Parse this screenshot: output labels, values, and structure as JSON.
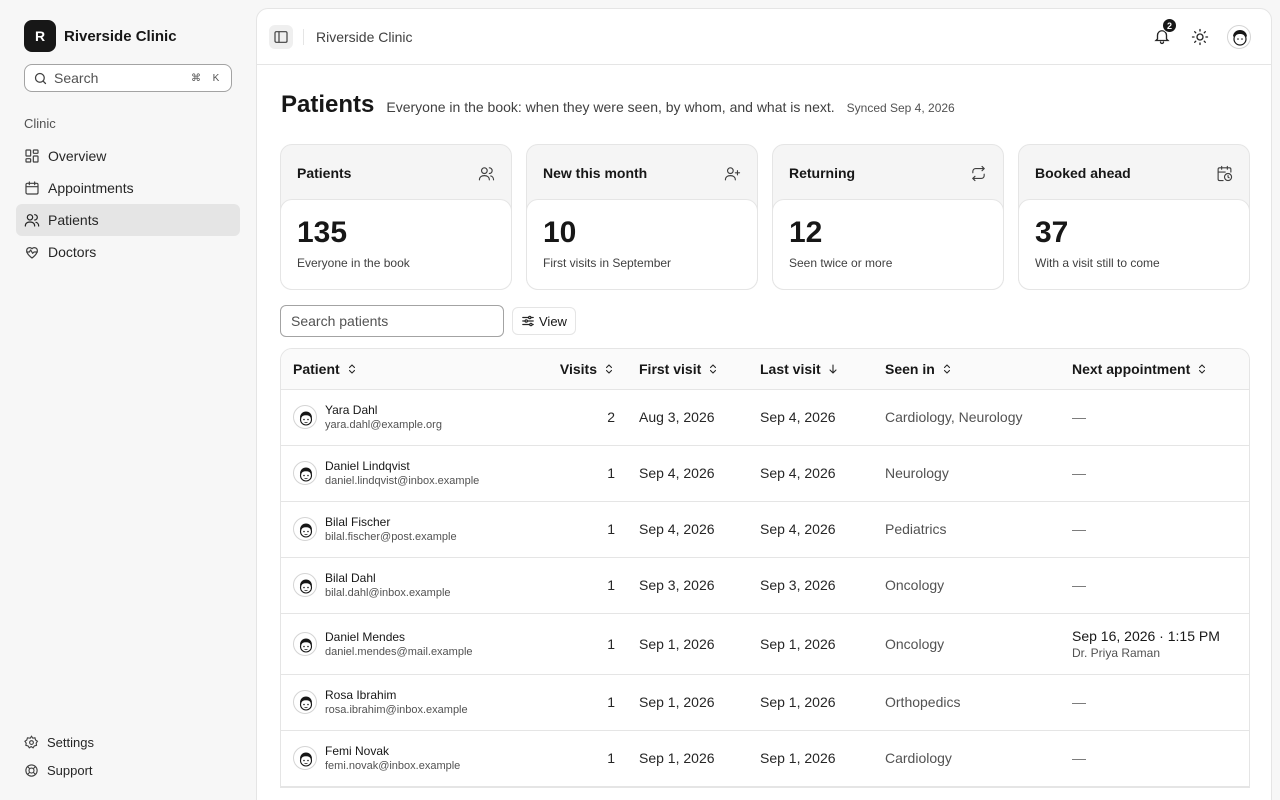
{
  "brand": {
    "initial": "R",
    "name": "Riverside Clinic"
  },
  "sidebar": {
    "search_label": "Search",
    "shortcut": [
      "⌘",
      "K"
    ],
    "group_label": "Clinic",
    "items": [
      {
        "label": "Overview",
        "icon": "grid-icon"
      },
      {
        "label": "Appointments",
        "icon": "calendar-icon"
      },
      {
        "label": "Patients",
        "icon": "users-icon",
        "active": true
      },
      {
        "label": "Doctors",
        "icon": "heart-pulse-icon"
      }
    ],
    "bottom": [
      {
        "label": "Settings",
        "icon": "gear-icon"
      },
      {
        "label": "Support",
        "icon": "lifebuoy-icon"
      }
    ]
  },
  "topbar": {
    "breadcrumb": "Riverside Clinic",
    "notification_count": "2"
  },
  "page": {
    "title": "Patients",
    "subtitle": "Everyone in the book: when they were seen, by whom, and what is next.",
    "synced": "Synced Sep 4, 2026"
  },
  "cards": [
    {
      "label": "Patients",
      "value": "135",
      "caption": "Everyone in the book",
      "icon": "users-icon"
    },
    {
      "label": "New this month",
      "value": "10",
      "caption": "First visits in September",
      "icon": "user-plus-icon"
    },
    {
      "label": "Returning",
      "value": "12",
      "caption": "Seen twice or more",
      "icon": "repeat-icon"
    },
    {
      "label": "Booked ahead",
      "value": "37",
      "caption": "With a visit still to come",
      "icon": "calendar-clock-icon"
    }
  ],
  "table": {
    "search_placeholder": "Search patients",
    "view_label": "View",
    "headers": {
      "patient": "Patient",
      "visits": "Visits",
      "first": "First visit",
      "last": "Last visit",
      "seen": "Seen in",
      "next": "Next appointment"
    },
    "rows": [
      {
        "name": "Yara Dahl",
        "email": "yara.dahl@example.org",
        "visits": "2",
        "first": "Aug 3, 2026",
        "last": "Sep 4, 2026",
        "seen": "Cardiology, Neurology",
        "next": "—",
        "doctor": ""
      },
      {
        "name": "Daniel Lindqvist",
        "email": "daniel.lindqvist@inbox.example",
        "visits": "1",
        "first": "Sep 4, 2026",
        "last": "Sep 4, 2026",
        "seen": "Neurology",
        "next": "—",
        "doctor": ""
      },
      {
        "name": "Bilal Fischer",
        "email": "bilal.fischer@post.example",
        "visits": "1",
        "first": "Sep 4, 2026",
        "last": "Sep 4, 2026",
        "seen": "Pediatrics",
        "next": "—",
        "doctor": ""
      },
      {
        "name": "Bilal Dahl",
        "email": "bilal.dahl@inbox.example",
        "visits": "1",
        "first": "Sep 3, 2026",
        "last": "Sep 3, 2026",
        "seen": "Oncology",
        "next": "—",
        "doctor": ""
      },
      {
        "name": "Daniel Mendes",
        "email": "daniel.mendes@mail.example",
        "visits": "1",
        "first": "Sep 1, 2026",
        "last": "Sep 1, 2026",
        "seen": "Oncology",
        "next": "Sep 16, 2026 · 1:15 PM",
        "doctor": "Dr. Priya Raman"
      },
      {
        "name": "Rosa Ibrahim",
        "email": "rosa.ibrahim@inbox.example",
        "visits": "1",
        "first": "Sep 1, 2026",
        "last": "Sep 1, 2026",
        "seen": "Orthopedics",
        "next": "—",
        "doctor": ""
      },
      {
        "name": "Femi Novak",
        "email": "femi.novak@inbox.example",
        "visits": "1",
        "first": "Sep 1, 2026",
        "last": "Sep 1, 2026",
        "seen": "Cardiology",
        "next": "—",
        "doctor": ""
      }
    ]
  }
}
